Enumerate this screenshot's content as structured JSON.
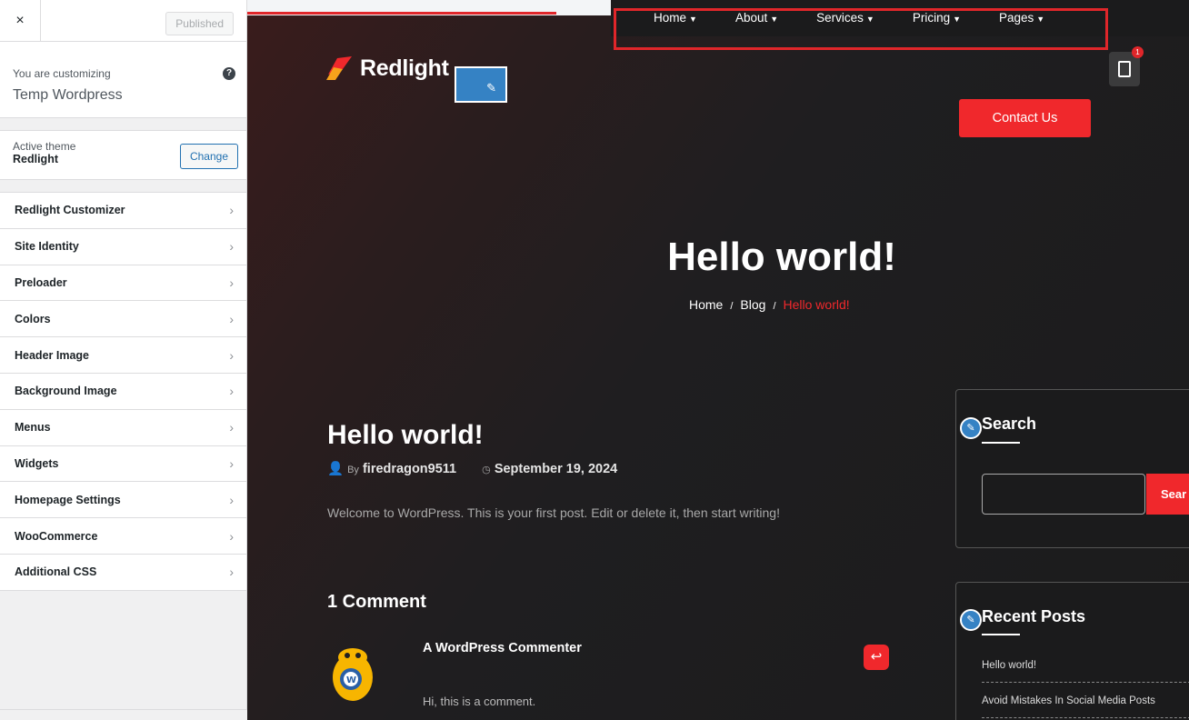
{
  "customizer": {
    "close_glyph": "×",
    "publish_label": "Published",
    "customizing_label": "You are customizing",
    "site_name": "Temp Wordpress",
    "help_glyph": "?",
    "active_theme_label": "Active theme",
    "active_theme_name": "Redlight",
    "change_label": "Change",
    "menu": [
      {
        "label": "Redlight Customizer"
      },
      {
        "label": "Site Identity"
      },
      {
        "label": "Preloader"
      },
      {
        "label": "Colors"
      },
      {
        "label": "Header Image"
      },
      {
        "label": "Background Image"
      },
      {
        "label": "Menus"
      },
      {
        "label": "Widgets"
      },
      {
        "label": "Homepage Settings"
      },
      {
        "label": "WooCommerce"
      },
      {
        "label": "Additional CSS"
      }
    ]
  },
  "site": {
    "logo_text": "Redlight",
    "nav": [
      {
        "label": "Home"
      },
      {
        "label": "About"
      },
      {
        "label": "Services"
      },
      {
        "label": "Pricing"
      },
      {
        "label": "Pages"
      }
    ],
    "cart_count": "1",
    "contact_label": "Contact Us",
    "hero_title": "Hello world!",
    "breadcrumb": {
      "home": "Home",
      "blog": "Blog",
      "current": "Hello world!",
      "sep": "/"
    },
    "post": {
      "title": "Hello world!",
      "by": "By",
      "author": "firedragon9511",
      "date": "September 19, 2024",
      "excerpt": "Welcome to WordPress. This is your first post. Edit or delete it, then start writing!"
    },
    "comments_title": "1 Comment",
    "comment": {
      "author": "A WordPress Commenter",
      "text": "Hi, this is a comment."
    },
    "widgets": {
      "search_title": "Search",
      "search_button": "Sear",
      "recent_title": "Recent Posts",
      "recent_posts": [
        "Hello world!",
        "Avoid Mistakes In Social Media Posts"
      ]
    }
  },
  "colors": {
    "accent": "#f0282c",
    "wp_blue": "#2271b1",
    "annotation_red": "#e0262a"
  }
}
